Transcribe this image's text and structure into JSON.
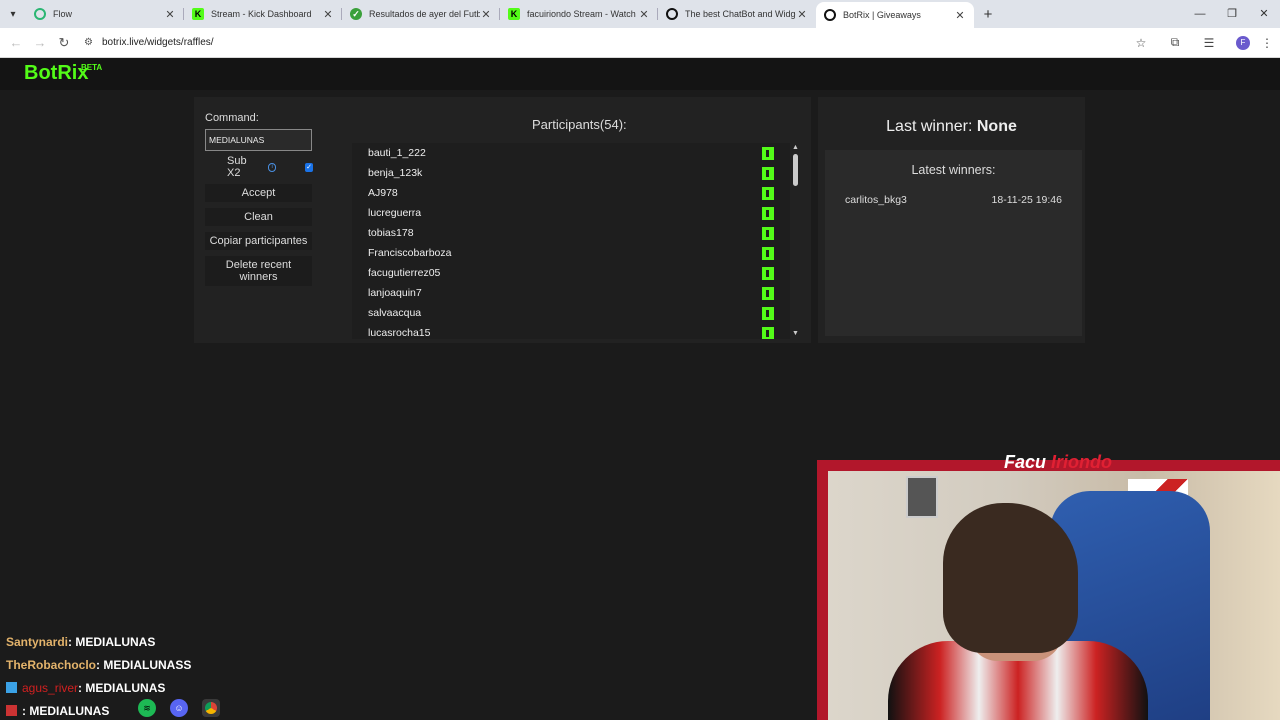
{
  "browser": {
    "tabs": [
      {
        "title": "Flow",
        "favicon": "flow-icon",
        "color": "#2bb673"
      },
      {
        "title": "Stream - Kick Dashboard",
        "favicon": "kick-icon",
        "color": "#53fc18"
      },
      {
        "title": "Resultados de ayer del Futbol A",
        "favicon": "soccer-icon",
        "color": "#3aa03a"
      },
      {
        "title": "facuiriondo Stream - Watch Live",
        "favicon": "kick-icon",
        "color": "#53fc18"
      },
      {
        "title": "The best ChatBot and Widgets",
        "favicon": "botrix-icon",
        "color": "#111111"
      },
      {
        "title": "BotRix | Giveaways",
        "favicon": "botrix-icon",
        "color": "#111111"
      }
    ],
    "url": "botrix.live/widgets/raffles/",
    "profile_initial": "F"
  },
  "site": {
    "logo": "BotRix",
    "logo_badge": "BETA",
    "accent": "#53fc18"
  },
  "controls": {
    "command_label": "Command:",
    "command_value": "MEDIALUNAS",
    "sub_label": "Sub X2",
    "sub_checked": true,
    "accept": "Accept",
    "clean": "Clean",
    "copy": "Copiar participantes",
    "delete": "Delete recent winners"
  },
  "participants": {
    "title": "Participants(54):",
    "items": [
      "bauti_1_222",
      "benja_123k",
      "AJ978",
      "lucreguerra",
      "tobias178",
      "Franciscobarboza",
      "facugutierrez05",
      "lanjoaquin7",
      "salvaacqua",
      "lucasrocha15"
    ]
  },
  "winners": {
    "last_label": "Last winner:",
    "last_value": "None",
    "latest_title": "Latest winners:",
    "rows": [
      {
        "name": "carlitos_bkg3",
        "date": "18-11-25 19:46"
      }
    ]
  },
  "stream": {
    "cam_name_1": "Facu",
    "cam_name_2": "Iriondo",
    "chat": [
      {
        "user": "Santynardi",
        "message": " : MEDIALUNAS"
      },
      {
        "user": "TheRobachoclo",
        "message": " : MEDIALUNASS"
      },
      {
        "user": "agus_river",
        "message": " : MEDIALUNAS"
      },
      {
        "user": "",
        "message": " : MEDIALUNAS"
      }
    ]
  }
}
